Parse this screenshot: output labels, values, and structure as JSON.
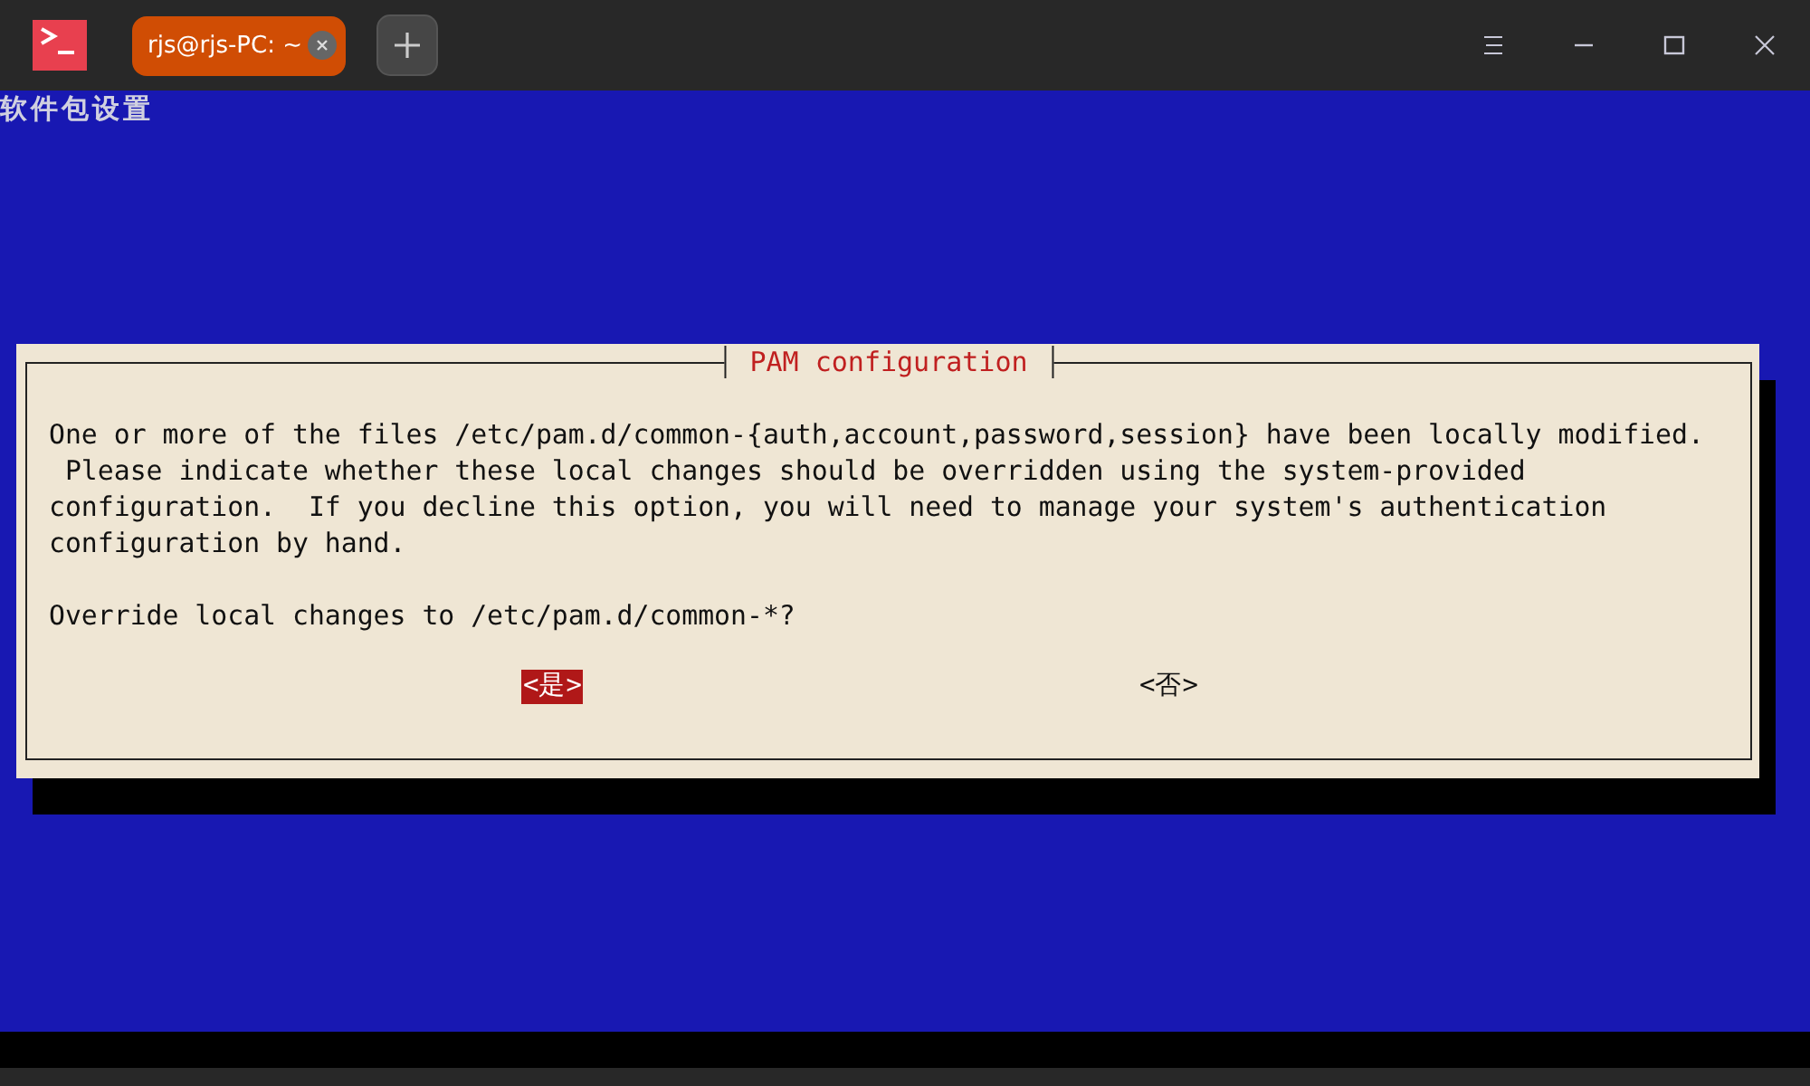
{
  "window": {
    "tab": {
      "title": "rjs@rjs-PC: ~",
      "selected": true
    }
  },
  "terminal": {
    "backtitle": "软件包设置",
    "dialog": {
      "title": "PAM configuration",
      "paragraphs": [
        [
          "One or more of the files /etc/pam.d/common-{auth,account,password,session} have been locally modified.",
          " Please indicate whether these local changes should be overridden using the system-provided",
          "configuration.  If you decline this option, you will need to manage your system's authentication",
          "configuration by hand."
        ],
        [
          "Override local changes to /etc/pam.d/common-*?"
        ]
      ],
      "buttons": [
        {
          "label": "<是>",
          "selected": true
        },
        {
          "label": "<否>",
          "selected": false
        }
      ]
    }
  }
}
